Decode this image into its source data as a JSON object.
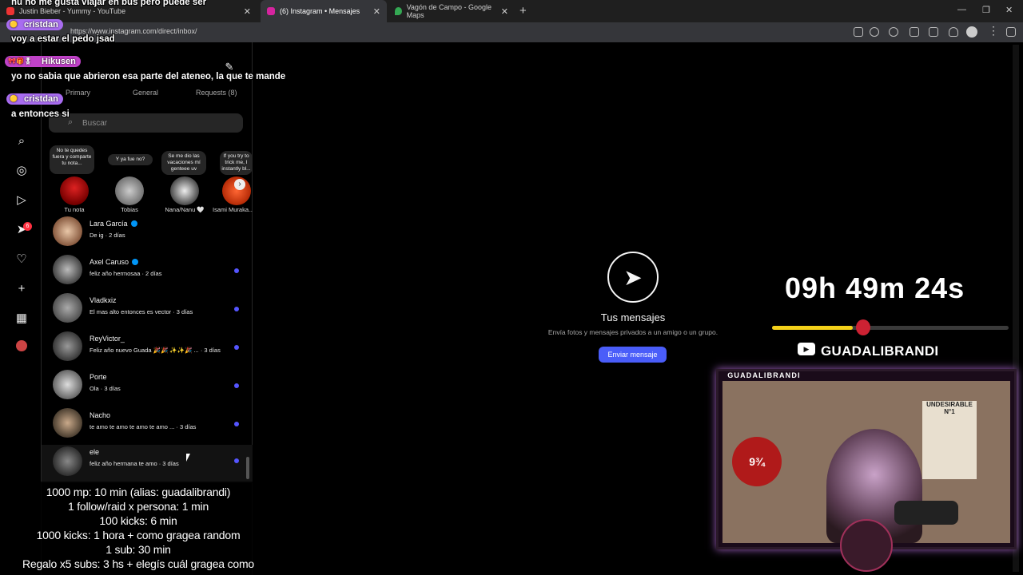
{
  "browser": {
    "tabs": [
      {
        "label": "Justin Bieber - Yummy - YouTube",
        "active": false
      },
      {
        "label": "(6) Instagram • Mensajes",
        "active": true
      },
      {
        "label": "Vagón de Campo - Google Maps",
        "active": false
      }
    ],
    "url": "https://www.instagram.com/direct/inbox/"
  },
  "instagram": {
    "nav_badge": "6",
    "inbox_tabs": [
      "Primary",
      "General",
      "Requests (8)"
    ],
    "search_placeholder": "Buscar",
    "notes": [
      {
        "note": "No te quedes fuera y comparte tu nota...",
        "label": "Tu nota"
      },
      {
        "note": "Y ya fue no?",
        "label": "Tobias"
      },
      {
        "note": "Se me dio las vacaciones mí genteee uv",
        "label": "Nana/Nanu 🤍"
      },
      {
        "note": "If you try to trick me, I instantly bl...",
        "label": "Isami Muraka..."
      }
    ],
    "conversations": [
      {
        "name": "Lara García",
        "verified": true,
        "message": "De ig · 2 días",
        "unread": false
      },
      {
        "name": "Axel Caruso",
        "verified": true,
        "message": "feliz año hermosaa · 2 días",
        "unread": true
      },
      {
        "name": "Vladkxiz",
        "verified": false,
        "message": "El mas alto entonces es vector · 3 días",
        "unread": true
      },
      {
        "name": "ReyVictor_",
        "verified": false,
        "message": "Feliz año nuevo Guada 🎉🎉 ✨✨🎉 ... · 3 días",
        "unread": true
      },
      {
        "name": "Porte",
        "verified": false,
        "message": "Ola · 3 días",
        "unread": true
      },
      {
        "name": "Nacho",
        "verified": false,
        "message": "te amo te amo te amo te amo ... · 3 días",
        "unread": true
      },
      {
        "name": "ele",
        "verified": false,
        "message": "feliz año hermana te amo · 3 días",
        "unread": true
      }
    ],
    "empty": {
      "title": "Tus mensajes",
      "subtitle": "Envía fotos y mensajes privados a un amigo o un grupo.",
      "button": "Enviar mensaje"
    }
  },
  "stream": {
    "chat": [
      {
        "user": "",
        "text": "hu no me gusta viajar en bus pero puede ser"
      },
      {
        "user": "cristdan",
        "text": "voy a estar el pedo jsad"
      },
      {
        "user": "Hikusen",
        "text": "yo no sabia que abrieron esa parte del ateneo, la que te mande"
      },
      {
        "user": "cristdan",
        "text": "a entonces si"
      }
    ],
    "rules": [
      "1000 mp: 10 min (alias: guadalibrandi)",
      "1 follow/raid x persona: 1 min",
      "100 kicks: 6 min",
      "1000 kicks: 1 hora + como gragea random",
      "1 sub: 30 min",
      "Regalo x5 subs: 3 hs + elegís cuál gragea como"
    ],
    "timer": "09h 49m 24s",
    "timer_progress": 0.34,
    "youtube_handle": "GUADALIBRANDI",
    "cam_label": "GUADALIBRANDI",
    "colors": {
      "accent": "#4a5df9",
      "unread_dot": "#5555ff",
      "progress": "#f4d11a",
      "chat_name_bg": "#a86cf0"
    }
  }
}
